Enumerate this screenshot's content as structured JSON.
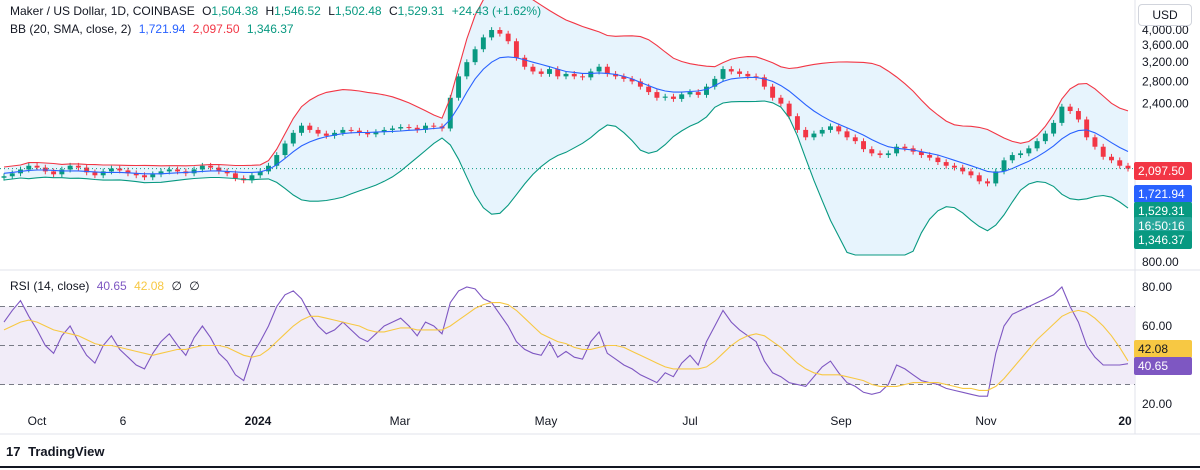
{
  "header": {
    "symbol": "Maker / US Dollar, 1D, COINBASE",
    "open_label": "O",
    "open": "1,504.38",
    "high_label": "H",
    "high": "1,546.52",
    "low_label": "L",
    "low": "1,502.48",
    "close_label": "C",
    "close": "1,529.31",
    "change": "+24.43 (+1.62%)",
    "currency": "USD"
  },
  "bb_legend": {
    "label": "BB (20, SMA, close, 2)",
    "basis": "1,721.94",
    "upper": "2,097.50",
    "lower": "1,346.37"
  },
  "rsi_legend": {
    "label": "RSI (14, close)",
    "rsi": "40.65",
    "ma": "42.08",
    "icon_a": "∅",
    "icon_b": "∅"
  },
  "price_tags": {
    "upper": "2,097.50",
    "basis": "1,721.94",
    "close": "1,529.31",
    "countdown": "16:50:16",
    "lower": "1,346.37",
    "rsi_ma": "42.08",
    "rsi": "40.65"
  },
  "brand": {
    "logo": "17",
    "name": "TradingView"
  },
  "colors": {
    "up": "#089981",
    "down": "#f23645",
    "basis": "#2962ff",
    "upper": "#f23645",
    "lower": "#089981",
    "band_fill": "#e3f2fd",
    "rsi_line": "#7e57c2",
    "rsi_ma": "#f7c843",
    "rsi_band": "#ede7f6"
  },
  "chart_data": [
    {
      "type": "line",
      "description_kind": "candlestick with Bollinger Bands",
      "x_ticks": [
        "Oct",
        "6",
        "2024",
        "Mar",
        "May",
        "Jul",
        "Sep",
        "Nov",
        "20"
      ],
      "y_ticks": [
        "4,000.00",
        "3,600.00",
        "3,200.00",
        "2,800.00",
        "2,400.00",
        "800.00"
      ],
      "series": [
        {
          "name": "close",
          "values": [
            1450,
            1480,
            1520,
            1560,
            1540,
            1500,
            1470,
            1520,
            1560,
            1540,
            1490,
            1460,
            1500,
            1530,
            1510,
            1480,
            1460,
            1440,
            1470,
            1500,
            1520,
            1500,
            1480,
            1520,
            1560,
            1540,
            1500,
            1480,
            1430,
            1410,
            1460,
            1500,
            1560,
            1680,
            1820,
            1960,
            2060,
            2000,
            1950,
            1920,
            1960,
            2000,
            1990,
            1960,
            1940,
            1970,
            2000,
            2020,
            2040,
            2030,
            2000,
            2060,
            2050,
            2020,
            2500,
            2900,
            3200,
            3500,
            3800,
            4000,
            3900,
            3700,
            3300,
            3100,
            3000,
            2950,
            3050,
            2900,
            2950,
            2900,
            2880,
            3000,
            3100,
            2950,
            2900,
            2850,
            2800,
            2700,
            2600,
            2500,
            2520,
            2480,
            2560,
            2600,
            2550,
            2700,
            2850,
            3050,
            3000,
            2950,
            2900,
            2880,
            2700,
            2500,
            2400,
            2200,
            2000,
            1900,
            1950,
            2000,
            2050,
            1980,
            1900,
            1850,
            1750,
            1700,
            1680,
            1700,
            1780,
            1760,
            1720,
            1680,
            1650,
            1600,
            1560,
            1540,
            1500,
            1460,
            1400,
            1380,
            1500,
            1620,
            1680,
            1700,
            1760,
            1850,
            1950,
            2100,
            2350,
            2280,
            2150,
            1900,
            1780,
            1660,
            1620,
            1560,
            1529
          ]
        },
        {
          "name": "basis",
          "values": [
            1480,
            1490,
            1500,
            1510,
            1515,
            1515,
            1510,
            1505,
            1505,
            1505,
            1500,
            1495,
            1490,
            1490,
            1490,
            1485,
            1480,
            1475,
            1475,
            1475,
            1480,
            1485,
            1490,
            1495,
            1500,
            1505,
            1505,
            1500,
            1495,
            1490,
            1490,
            1495,
            1520,
            1570,
            1640,
            1720,
            1790,
            1840,
            1880,
            1910,
            1930,
            1950,
            1960,
            1965,
            1965,
            1970,
            1975,
            1980,
            1985,
            1995,
            2000,
            2010,
            2020,
            2030,
            2150,
            2350,
            2600,
            2850,
            3050,
            3200,
            3300,
            3320,
            3300,
            3250,
            3200,
            3150,
            3100,
            3050,
            3000,
            2980,
            2960,
            2960,
            2970,
            2960,
            2940,
            2900,
            2850,
            2780,
            2720,
            2660,
            2620,
            2600,
            2600,
            2610,
            2620,
            2650,
            2720,
            2800,
            2850,
            2870,
            2880,
            2880,
            2850,
            2800,
            2720,
            2620,
            2500,
            2380,
            2280,
            2200,
            2130,
            2080,
            2030,
            1980,
            1930,
            1870,
            1820,
            1780,
            1760,
            1750,
            1740,
            1720,
            1700,
            1680,
            1650,
            1620,
            1590,
            1560,
            1530,
            1500,
            1490,
            1500,
            1530,
            1570,
            1610,
            1660,
            1720,
            1790,
            1880,
            1950,
            1990,
            2000,
            1960,
            1900,
            1830,
            1770,
            1722
          ]
        }
      ]
    },
    {
      "type": "line",
      "x_ticks": [
        "Oct",
        "6",
        "2024",
        "Mar",
        "May",
        "Jul",
        "Sep",
        "Nov",
        "20"
      ],
      "y_ticks": [
        "80.00",
        "60.00",
        "20.00"
      ],
      "ylim": [
        20,
        80
      ],
      "bands": [
        70,
        50,
        30
      ],
      "series": [
        {
          "name": "RSI",
          "values": [
            62,
            68,
            73,
            65,
            58,
            50,
            46,
            55,
            60,
            52,
            45,
            41,
            50,
            55,
            48,
            44,
            40,
            38,
            46,
            52,
            56,
            50,
            45,
            54,
            60,
            54,
            46,
            42,
            35,
            32,
            45,
            52,
            60,
            70,
            76,
            78,
            74,
            66,
            60,
            56,
            58,
            62,
            58,
            54,
            52,
            56,
            60,
            62,
            64,
            60,
            55,
            62,
            60,
            56,
            72,
            78,
            80,
            79,
            74,
            72,
            66,
            60,
            52,
            48,
            46,
            45,
            52,
            44,
            47,
            44,
            43,
            52,
            57,
            46,
            43,
            40,
            38,
            35,
            33,
            31,
            36,
            34,
            41,
            45,
            40,
            52,
            60,
            68,
            62,
            58,
            55,
            52,
            42,
            36,
            34,
            31,
            30,
            29,
            34,
            39,
            42,
            36,
            31,
            29,
            26,
            25,
            26,
            30,
            40,
            38,
            35,
            32,
            31,
            30,
            28,
            27,
            26,
            25,
            24,
            24,
            46,
            60,
            66,
            68,
            70,
            72,
            74,
            76,
            80,
            70,
            62,
            50,
            44,
            40,
            40,
            40,
            40.65
          ]
        },
        {
          "name": "RSI-based MA",
          "values": [
            58,
            60,
            62,
            63,
            62,
            60,
            58,
            57,
            56,
            55,
            53,
            51,
            50,
            50,
            49,
            48,
            47,
            46,
            45,
            46,
            47,
            48,
            48,
            49,
            50,
            50,
            50,
            49,
            47,
            45,
            44,
            45,
            48,
            52,
            56,
            60,
            63,
            65,
            65,
            64,
            63,
            62,
            61,
            60,
            58,
            57,
            57,
            58,
            59,
            59,
            58,
            58,
            58,
            58,
            60,
            63,
            66,
            69,
            71,
            72,
            72,
            71,
            68,
            64,
            60,
            56,
            54,
            52,
            51,
            49,
            48,
            48,
            49,
            50,
            50,
            49,
            47,
            45,
            43,
            41,
            39,
            38,
            38,
            38,
            38,
            39,
            42,
            46,
            50,
            53,
            55,
            56,
            55,
            52,
            49,
            45,
            41,
            38,
            36,
            35,
            35,
            35,
            34,
            33,
            32,
            30,
            29,
            29,
            29,
            30,
            31,
            31,
            31,
            31,
            30,
            29,
            28,
            28,
            27,
            27,
            29,
            33,
            38,
            43,
            48,
            53,
            57,
            61,
            65,
            67,
            68,
            67,
            64,
            60,
            55,
            49,
            42.08
          ]
        }
      ]
    }
  ]
}
